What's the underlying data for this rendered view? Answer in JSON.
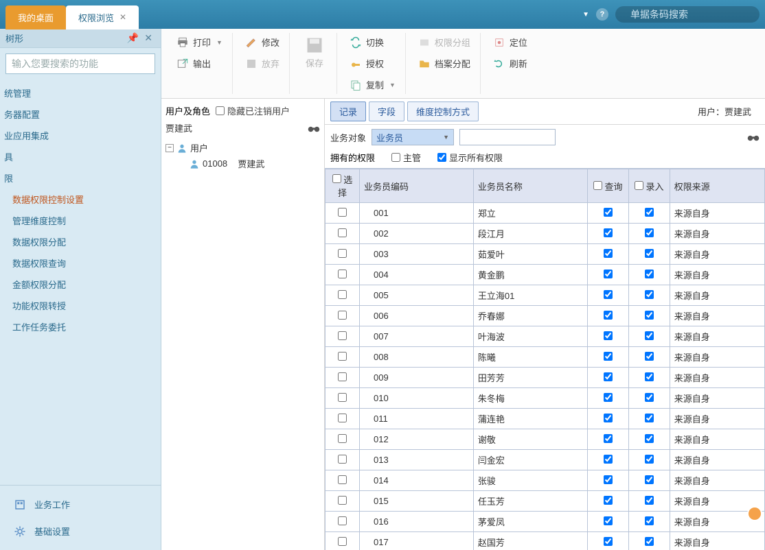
{
  "topbar": {
    "tabs": [
      {
        "label": "我的桌面",
        "kind": "orange"
      },
      {
        "label": "权限浏览",
        "kind": "white",
        "closeable": true
      }
    ],
    "search_placeholder": "单据条码搜索"
  },
  "sidebar": {
    "title": "树形",
    "search_placeholder": "输入您要搜索的功能",
    "nav": [
      {
        "label": "统管理",
        "sub": []
      },
      {
        "label": "务器配置",
        "sub": []
      },
      {
        "label": "业应用集成",
        "sub": []
      },
      {
        "label": "具",
        "sub": []
      },
      {
        "label": "限",
        "sub": [
          {
            "label": "数据权限控制设置",
            "active": true
          },
          {
            "label": "管理维度控制"
          },
          {
            "label": "数据权限分配"
          },
          {
            "label": "数据权限查询"
          },
          {
            "label": "金额权限分配"
          },
          {
            "label": "功能权限转授"
          },
          {
            "label": "工作任务委托"
          }
        ]
      }
    ],
    "bottom": [
      {
        "label": "业务工作",
        "icon": "biz"
      },
      {
        "label": "基础设置",
        "icon": "gear"
      }
    ]
  },
  "toolbar": {
    "print": "打印",
    "output": "输出",
    "modify": "修改",
    "discard": "放弃",
    "save": "保存",
    "switch": "切换",
    "authorize": "授权",
    "copy": "复制",
    "perm_group": "权限分组",
    "file_assign": "档案分配",
    "locate": "定位",
    "refresh": "刷新"
  },
  "tree": {
    "header": "用户及角色",
    "hide_label": "隐藏已注销用户",
    "current_user": "贾建武",
    "root": "用户",
    "child_code": "01008",
    "child_name": "贾建武"
  },
  "right": {
    "subtabs": [
      "记录",
      "字段",
      "维度控制方式"
    ],
    "user_label": "用户：",
    "user_name": "贾建武",
    "biz_obj_label": "业务对象",
    "biz_obj_value": "业务员",
    "owned_label": "拥有的权限",
    "supervisor": "主管",
    "show_all": "显示所有权限",
    "columns": {
      "select": "选择",
      "code": "业务员编码",
      "name": "业务员名称",
      "query": "查询",
      "entry": "录入",
      "source": "权限来源"
    },
    "rows": [
      {
        "code": "001",
        "name": "郑立",
        "q": true,
        "e": true,
        "src": "来源自身"
      },
      {
        "code": "002",
        "name": "段江月",
        "q": true,
        "e": true,
        "src": "来源自身"
      },
      {
        "code": "003",
        "name": "茹爱叶",
        "q": true,
        "e": true,
        "src": "来源自身"
      },
      {
        "code": "004",
        "name": "黄金鹏",
        "q": true,
        "e": true,
        "src": "来源自身"
      },
      {
        "code": "005",
        "name": "王立海01",
        "q": true,
        "e": true,
        "src": "来源自身"
      },
      {
        "code": "006",
        "name": "乔春娜",
        "q": true,
        "e": true,
        "src": "来源自身"
      },
      {
        "code": "007",
        "name": "叶海波",
        "q": true,
        "e": true,
        "src": "来源自身"
      },
      {
        "code": "008",
        "name": "陈曦",
        "q": true,
        "e": true,
        "src": "来源自身"
      },
      {
        "code": "009",
        "name": "田芳芳",
        "q": true,
        "e": true,
        "src": "来源自身"
      },
      {
        "code": "010",
        "name": "朱冬梅",
        "q": true,
        "e": true,
        "src": "来源自身"
      },
      {
        "code": "011",
        "name": "蒲连艳",
        "q": true,
        "e": true,
        "src": "来源自身"
      },
      {
        "code": "012",
        "name": "谢敬",
        "q": true,
        "e": true,
        "src": "来源自身"
      },
      {
        "code": "013",
        "name": "闫金宏",
        "q": true,
        "e": true,
        "src": "来源自身"
      },
      {
        "code": "014",
        "name": "张骏",
        "q": true,
        "e": true,
        "src": "来源自身"
      },
      {
        "code": "015",
        "name": "任玉芳",
        "q": true,
        "e": true,
        "src": "来源自身"
      },
      {
        "code": "016",
        "name": "茅爱凤",
        "q": true,
        "e": true,
        "src": "来源自身"
      },
      {
        "code": "017",
        "name": "赵国芳",
        "q": true,
        "e": true,
        "src": "来源自身"
      }
    ]
  }
}
